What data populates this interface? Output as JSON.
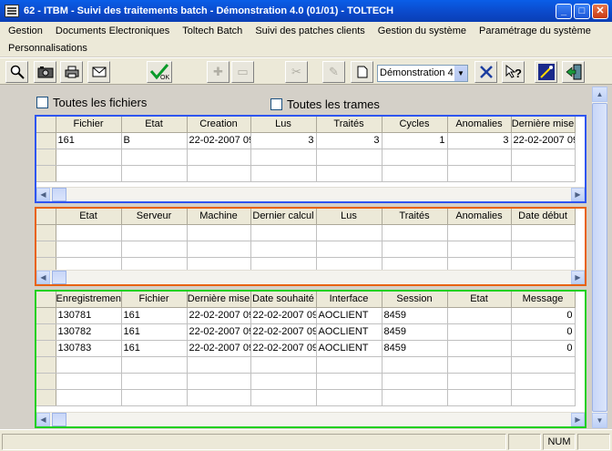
{
  "window": {
    "title": "62 - ITBM - Suivi des traitements batch - Démonstration 4.0 (01/01) - TOLTECH"
  },
  "menu": {
    "row1": [
      "Gestion",
      "Documents Electroniques",
      "Toltech Batch",
      "Suivi des patches clients",
      "Gestion du système",
      "Paramétrage du système"
    ],
    "row2": [
      "Personnalisations"
    ]
  },
  "toolbar": {
    "combo_value": "Démonstration 4"
  },
  "filters": {
    "all_files_label": "Toutes les fichiers",
    "all_frames_label": "Toutes les trames"
  },
  "grid_files": {
    "columns": [
      "Fichier",
      "Etat",
      "Creation",
      "Lus",
      "Traités",
      "Cycles",
      "Anomalies",
      "Dernière mise"
    ],
    "rows": [
      [
        "161",
        "B",
        "22-02-2007 09",
        "3",
        "3",
        "1",
        "3",
        "22-02-2007 09"
      ]
    ]
  },
  "grid_runs": {
    "columns": [
      "Etat",
      "Serveur",
      "Machine",
      "Dernier calcul",
      "Lus",
      "Traités",
      "Anomalies",
      "Date début"
    ],
    "rows": []
  },
  "grid_records": {
    "columns": [
      "Enregistremen",
      "Fichier",
      "Dernière mise",
      "Date  souhaité",
      "Interface",
      "Session",
      "Etat",
      "Message"
    ],
    "rows": [
      [
        "130781",
        "161",
        "22-02-2007 09",
        "22-02-2007 09",
        "AOCLIENT",
        "8459",
        "",
        "0"
      ],
      [
        "130782",
        "161",
        "22-02-2007 09",
        "22-02-2007 09",
        "AOCLIENT",
        "8459",
        "",
        "0"
      ],
      [
        "130783",
        "161",
        "22-02-2007 09",
        "22-02-2007 09",
        "AOCLIENT",
        "8459",
        "",
        "0"
      ]
    ]
  },
  "status": {
    "num": "NUM"
  },
  "colors": {
    "files_frame": "#2e55f0",
    "runs_frame": "#e8620c",
    "records_frame": "#1ed01e"
  }
}
